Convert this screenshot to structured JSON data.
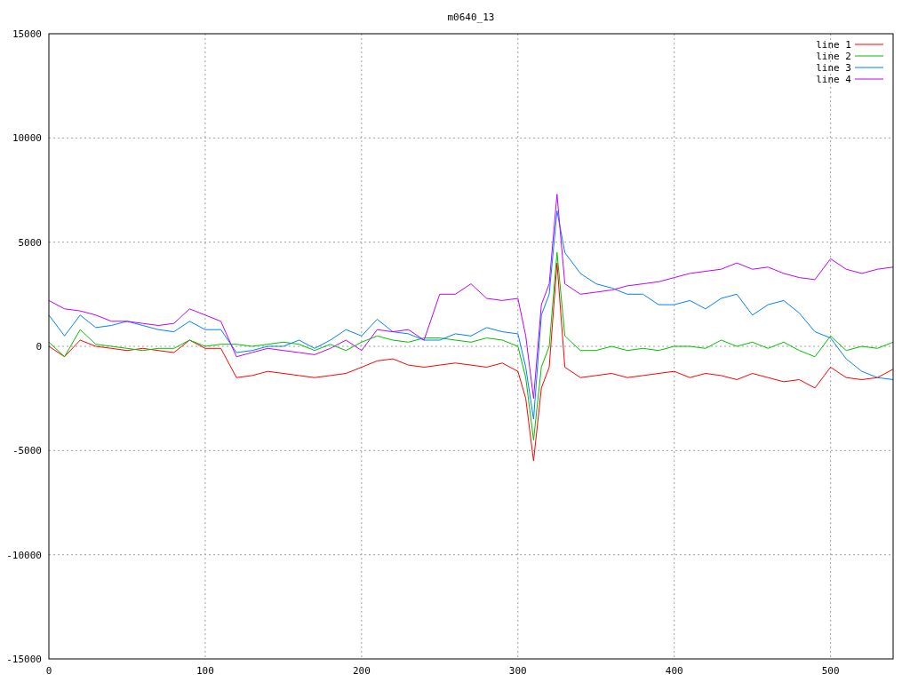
{
  "chart_data": {
    "type": "line",
    "title": "m0640_13",
    "grid": true,
    "legend": true,
    "xlim": [
      0,
      540
    ],
    "ylim": [
      -15000,
      15000
    ],
    "xticks": [
      0,
      100,
      200,
      300,
      400,
      500
    ],
    "yticks": [
      -15000,
      -10000,
      -5000,
      0,
      5000,
      10000,
      15000
    ],
    "x": [
      0,
      10,
      20,
      30,
      40,
      50,
      60,
      70,
      80,
      90,
      100,
      110,
      120,
      130,
      140,
      150,
      160,
      170,
      180,
      190,
      200,
      210,
      220,
      230,
      240,
      250,
      260,
      270,
      280,
      290,
      300,
      305,
      310,
      315,
      320,
      325,
      330,
      340,
      350,
      360,
      370,
      380,
      390,
      400,
      410,
      420,
      430,
      440,
      450,
      460,
      470,
      480,
      490,
      500,
      510,
      520,
      530,
      540
    ],
    "series": [
      {
        "name": "line 1",
        "color": "#ff0000",
        "values": [
          0,
          -500,
          300,
          0,
          -100,
          -200,
          -100,
          -200,
          -300,
          300,
          -100,
          -100,
          -1500,
          -1400,
          -1200,
          -1300,
          -1400,
          -1500,
          -1400,
          -1300,
          -1000,
          -700,
          -600,
          -900,
          -1000,
          -900,
          -800,
          -900,
          -1000,
          -800,
          -1200,
          -2500,
          -5500,
          -2000,
          -1000,
          4000,
          -1000,
          -1500,
          -1400,
          -1300,
          -1500,
          -1400,
          -1300,
          -1200,
          -1500,
          -1300,
          -1400,
          -1600,
          -1300,
          -1500,
          -1700,
          -1600,
          -2000,
          -1000,
          -1500,
          -1600,
          -1500,
          -1100
        ]
      },
      {
        "name": "line 2",
        "color": "#00c000",
        "values": [
          200,
          -500,
          800,
          100,
          0,
          -100,
          -200,
          -100,
          -100,
          300,
          0,
          100,
          100,
          0,
          100,
          200,
          100,
          -200,
          100,
          -200,
          200,
          500,
          300,
          200,
          400,
          400,
          300,
          200,
          400,
          300,
          0,
          -1500,
          -4500,
          -1000,
          0,
          4500,
          500,
          -200,
          -200,
          0,
          -200,
          -100,
          -200,
          0,
          0,
          -100,
          300,
          0,
          200,
          -100,
          200,
          -200,
          -500,
          500,
          -200,
          0,
          -100,
          200
        ]
      },
      {
        "name": "line 3",
        "color": "#0080ff",
        "values": [
          1500,
          500,
          1500,
          900,
          1000,
          1200,
          1000,
          800,
          700,
          1200,
          800,
          800,
          -300,
          -200,
          0,
          0,
          300,
          -100,
          300,
          800,
          500,
          1300,
          700,
          600,
          300,
          300,
          600,
          500,
          900,
          700,
          600,
          -1000,
          -3500,
          1500,
          2500,
          6500,
          4500,
          3500,
          3000,
          2800,
          2500,
          2500,
          2000,
          2000,
          2200,
          1800,
          2300,
          2500,
          1500,
          2000,
          2200,
          1600,
          700,
          400,
          -600,
          -1200,
          -1500,
          -1600
        ]
      },
      {
        "name": "line 4",
        "color": "#c000ff",
        "values": [
          2200,
          1800,
          1700,
          1500,
          1200,
          1200,
          1100,
          1000,
          1100,
          1800,
          1500,
          1200,
          -500,
          -300,
          -100,
          -200,
          -300,
          -400,
          -100,
          300,
          -200,
          800,
          700,
          800,
          300,
          2500,
          2500,
          3000,
          2300,
          2200,
          2300,
          500,
          -2500,
          2000,
          3000,
          7300,
          3000,
          2500,
          2600,
          2700,
          2900,
          3000,
          3100,
          3300,
          3500,
          3600,
          3700,
          4000,
          3700,
          3800,
          3500,
          3300,
          3200,
          4200,
          3700,
          3500,
          3700,
          3800
        ]
      }
    ]
  }
}
